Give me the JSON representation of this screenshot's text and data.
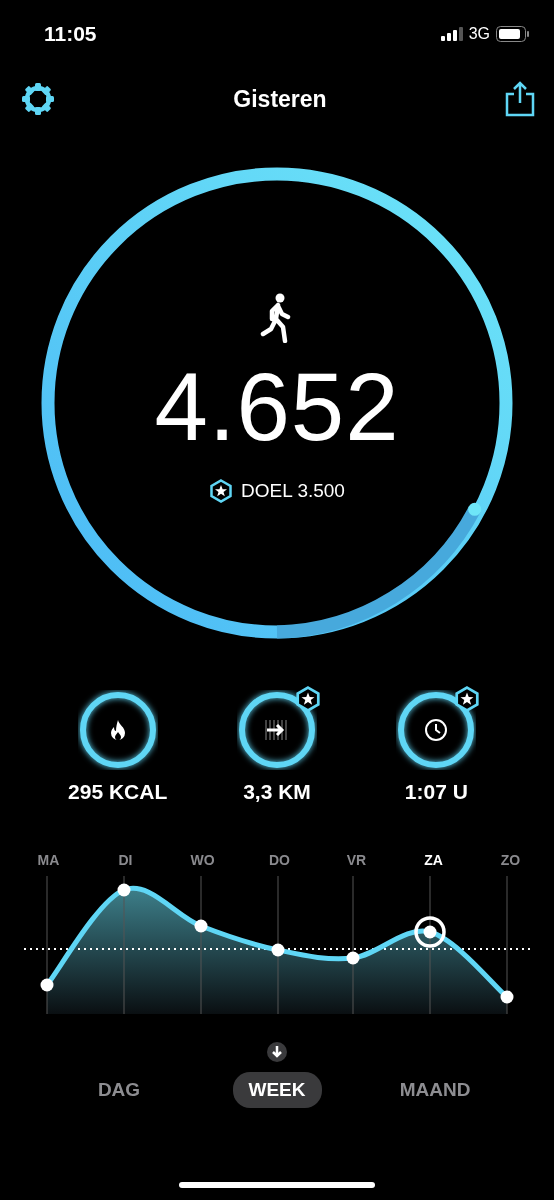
{
  "status_bar": {
    "time": "11:05",
    "network": "3G"
  },
  "nav": {
    "title": "Gisteren"
  },
  "steps": {
    "count": "4.652",
    "goal": "DOEL 3.500"
  },
  "stats": [
    {
      "kind": "flame",
      "value": "295 KCAL",
      "badge": false
    },
    {
      "kind": "distance",
      "value": "3,3 KM",
      "badge": true
    },
    {
      "kind": "clock",
      "value": "1:07 U",
      "badge": true
    }
  ],
  "days": [
    {
      "label": "MA",
      "selected": false
    },
    {
      "label": "DI",
      "selected": false
    },
    {
      "label": "WO",
      "selected": false
    },
    {
      "label": "DO",
      "selected": false
    },
    {
      "label": "VR",
      "selected": false
    },
    {
      "label": "ZA",
      "selected": true
    },
    {
      "label": "ZO",
      "selected": false
    }
  ],
  "periods": [
    {
      "label": "DAG",
      "selected": false
    },
    {
      "label": "WEEK",
      "selected": true
    },
    {
      "label": "MAAND",
      "selected": false
    }
  ]
}
